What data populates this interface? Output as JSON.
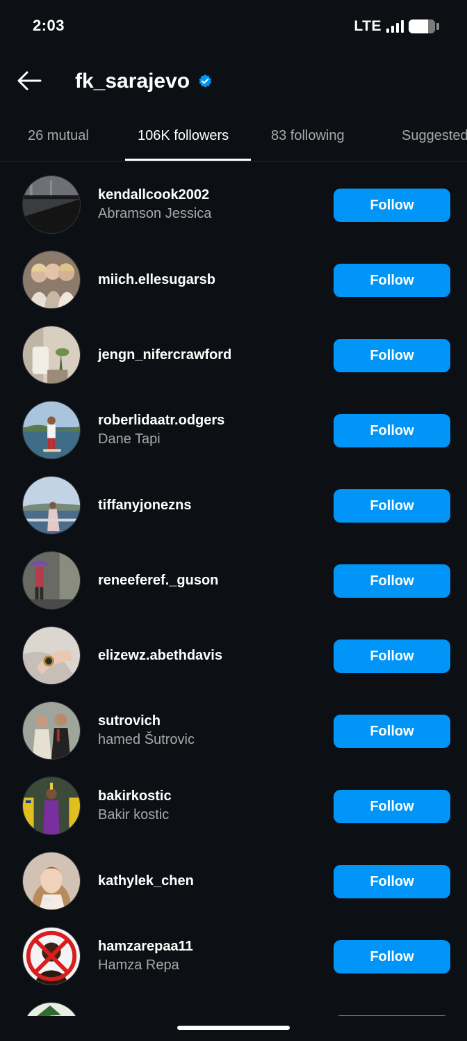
{
  "status_bar": {
    "time": "2:03",
    "network": "LTE"
  },
  "header": {
    "title": "fk_sarajevo",
    "verified_icon": "verified-badge-icon",
    "back_icon": "arrow-left-icon"
  },
  "tabs": [
    {
      "label": "26 mutual",
      "active": false
    },
    {
      "label": "106K followers",
      "active": true
    },
    {
      "label": "83 following",
      "active": false
    },
    {
      "label": "Suggested",
      "active": false
    }
  ],
  "colors": {
    "background": "#0c1014",
    "accent": "#0095f6",
    "secondary_text": "#a8a8a8",
    "verified": "#0095f6"
  },
  "followers": [
    {
      "username": "kendallcook2002",
      "full_name": "Abramson Jessica",
      "button": "Follow"
    },
    {
      "username": "miich.ellesugarsb",
      "full_name": "",
      "button": "Follow"
    },
    {
      "username": "jengn_nifercrawford",
      "full_name": "",
      "button": "Follow"
    },
    {
      "username": "roberlidaatr.odgers",
      "full_name": "Dane Tapi",
      "button": "Follow"
    },
    {
      "username": "tiffanyjonezns",
      "full_name": "",
      "button": "Follow"
    },
    {
      "username": "reneeferef._guson",
      "full_name": "",
      "button": "Follow"
    },
    {
      "username": "elizewz.abethdavis",
      "full_name": "",
      "button": "Follow"
    },
    {
      "username": "sutrovich",
      "full_name": "hamed Šutrovic",
      "button": "Follow"
    },
    {
      "username": "bakirkostic",
      "full_name": "Bakir kostic",
      "button": "Follow"
    },
    {
      "username": "kathylek_chen",
      "full_name": "",
      "button": "Follow"
    },
    {
      "username": "hamzarepaa11",
      "full_name": "Hamza Repa",
      "button": "Follow"
    },
    {
      "username": "",
      "full_name": "",
      "button": ""
    }
  ]
}
